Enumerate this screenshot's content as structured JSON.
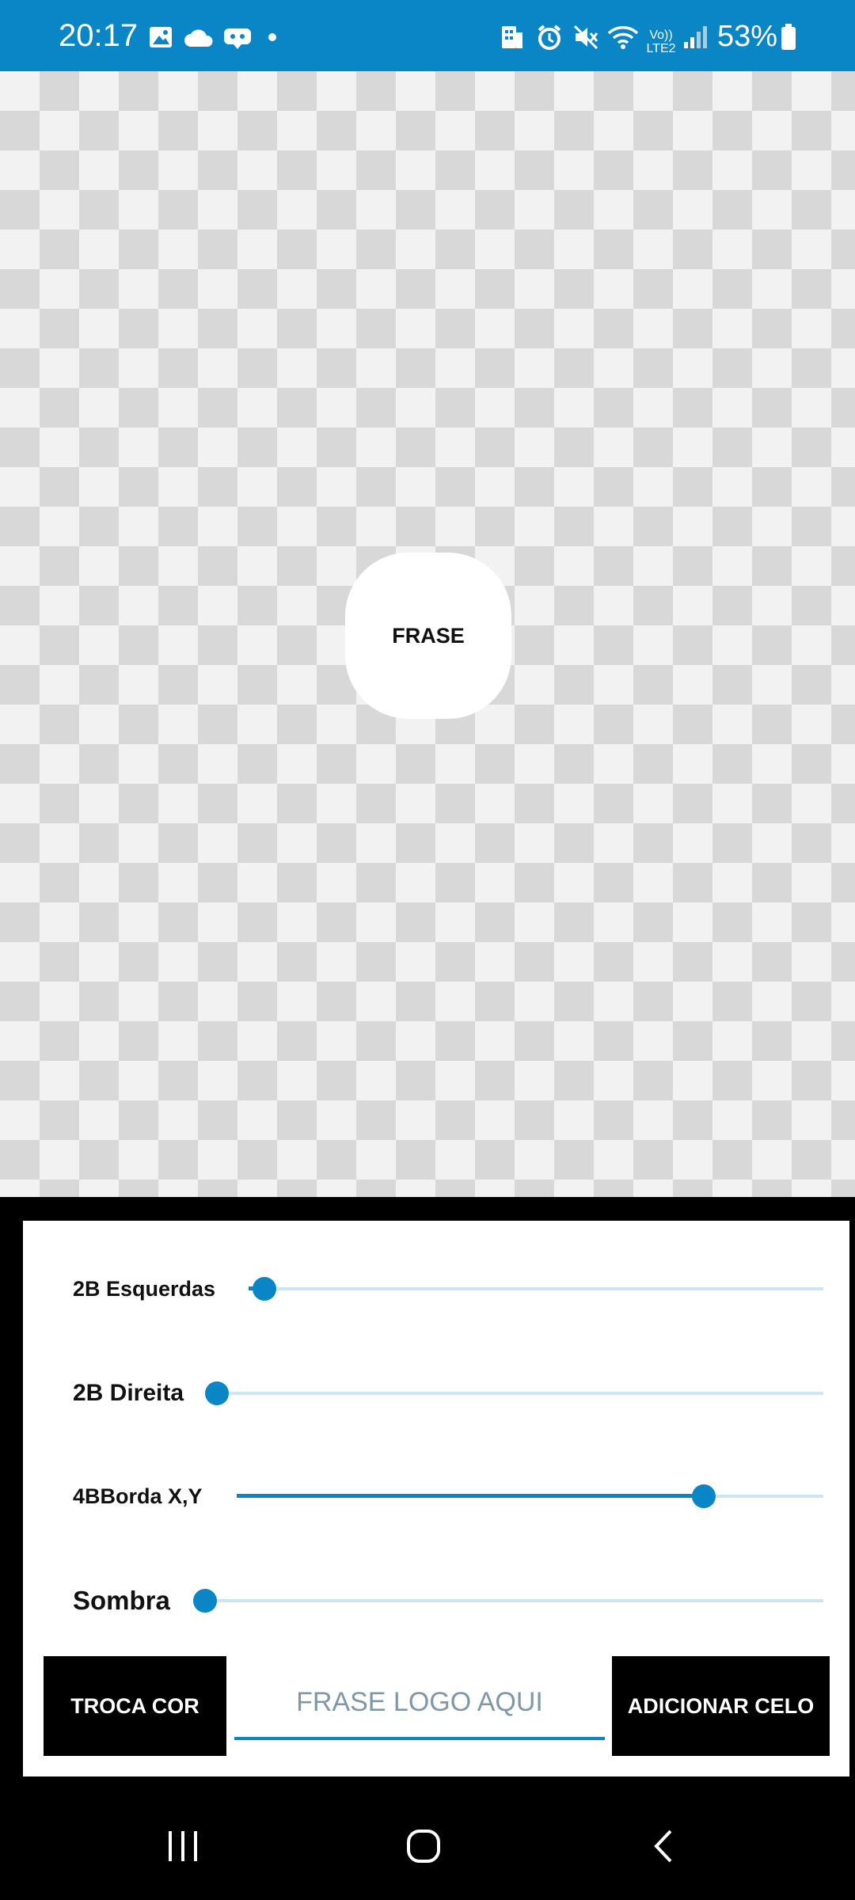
{
  "status_bar": {
    "time": "20:17",
    "battery_percent": "53%",
    "network_label_top": "Vo))",
    "network_label_bottom": "LTE2",
    "icons": [
      "image-icon",
      "cloud-icon",
      "game-icon",
      "dot-icon",
      "building-icon",
      "alarm-icon",
      "mute-icon",
      "wifi-icon",
      "signal-icon",
      "battery-icon"
    ]
  },
  "canvas": {
    "bubble_text": "FRASE"
  },
  "sliders": [
    {
      "label": "2B Esquerdas",
      "value_fraction": 0.03
    },
    {
      "label": "2B Direita",
      "value_fraction": 0.0
    },
    {
      "label": "4BBorda X,Y",
      "value_fraction": 0.83
    },
    {
      "label": "Sombra",
      "value_fraction": 0.0
    }
  ],
  "actions": {
    "change_color_label": "TROCA COR",
    "phrase_placeholder": "FRASE LOGO AQUI",
    "add_label": "ADICIONAR CELO"
  },
  "colors": {
    "accent": "#0a86c6",
    "track": "#cde6f4"
  }
}
